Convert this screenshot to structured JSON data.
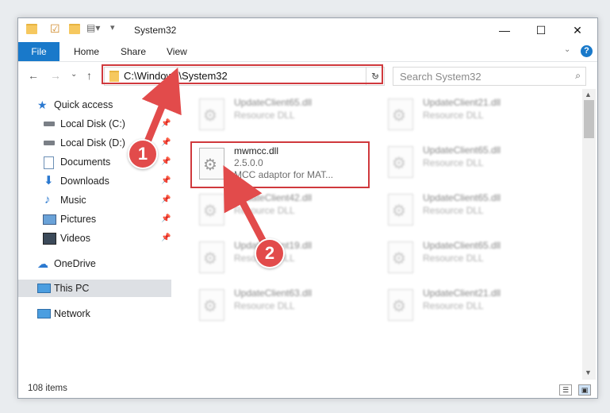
{
  "window": {
    "title": "System32",
    "controls": {
      "minimize": "—",
      "maximize": "☐",
      "close": "✕"
    }
  },
  "ribbon": {
    "tabs": [
      "File",
      "Home",
      "Share",
      "View"
    ],
    "help": "?"
  },
  "address": {
    "path": "C:\\Windows\\System32",
    "search_placeholder": "Search System32"
  },
  "sidebar": {
    "items": [
      {
        "label": "Quick access",
        "icon": "star-icon",
        "pinned": false
      },
      {
        "label": "Local Disk (C:)",
        "icon": "drive-icon",
        "pinned": true
      },
      {
        "label": "Local Disk (D:)",
        "icon": "drive-icon",
        "pinned": true
      },
      {
        "label": "Documents",
        "icon": "documents-icon",
        "pinned": true
      },
      {
        "label": "Downloads",
        "icon": "download-icon",
        "pinned": true
      },
      {
        "label": "Music",
        "icon": "music-icon",
        "pinned": true
      },
      {
        "label": "Pictures",
        "icon": "pictures-icon",
        "pinned": true
      },
      {
        "label": "Videos",
        "icon": "videos-icon",
        "pinned": true
      },
      {
        "label": "OneDrive",
        "icon": "cloud-icon",
        "pinned": false
      },
      {
        "label": "This PC",
        "icon": "computer-icon",
        "pinned": false
      },
      {
        "label": "Network",
        "icon": "network-icon",
        "pinned": false
      }
    ]
  },
  "files": {
    "highlighted": {
      "name": "mwmcc.dll",
      "version": "2.5.0.0",
      "description": "MCC adaptor for MAT..."
    },
    "background": [
      {
        "name": "UpdateClient65.dll",
        "type": "Resource DLL"
      },
      {
        "name": "UpdateClient21.dll",
        "type": "Resource DLL"
      },
      {
        "name": "UpdateClient65.dll",
        "type": "Resource DLL"
      },
      {
        "name": "UpdateClient42.dll",
        "type": "Resource DLL"
      },
      {
        "name": "UpdateClient65.dll",
        "type": "Resource DLL"
      },
      {
        "name": "UpdateClient19.dll",
        "type": "Resource DLL"
      },
      {
        "name": "UpdateClient65.dll",
        "type": "Resource DLL"
      },
      {
        "name": "UpdateClient63.dll",
        "type": "Resource DLL"
      },
      {
        "name": "UpdateClient21.dll",
        "type": "Resource DLL"
      }
    ]
  },
  "status": {
    "item_count": "108 items"
  },
  "annotations": {
    "step1": "1",
    "step2": "2",
    "color": "#e24b4b"
  }
}
